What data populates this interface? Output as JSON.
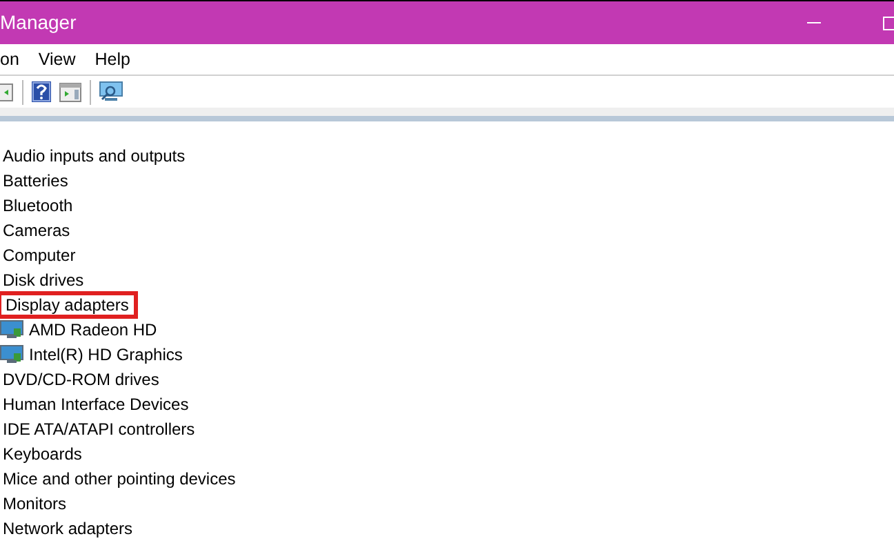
{
  "window": {
    "title": "Manager"
  },
  "menu": [
    "on",
    "View",
    "Help"
  ],
  "tree": [
    {
      "label": "Audio inputs and outputs",
      "highlighted": false
    },
    {
      "label": "Batteries",
      "highlighted": false
    },
    {
      "label": "Bluetooth",
      "highlighted": false
    },
    {
      "label": "Cameras",
      "highlighted": false
    },
    {
      "label": "Computer",
      "highlighted": false
    },
    {
      "label": "Disk drives",
      "highlighted": false
    },
    {
      "label": "Display adapters",
      "highlighted": true,
      "children": [
        {
          "label": "AMD Radeon HD"
        },
        {
          "label": "Intel(R) HD Graphics"
        }
      ]
    },
    {
      "label": "DVD/CD-ROM drives",
      "highlighted": false
    },
    {
      "label": "Human Interface Devices",
      "highlighted": false
    },
    {
      "label": "IDE ATA/ATAPI controllers",
      "highlighted": false
    },
    {
      "label": "Keyboards",
      "highlighted": false
    },
    {
      "label": "Mice and other pointing devices",
      "highlighted": false
    },
    {
      "label": "Monitors",
      "highlighted": false
    },
    {
      "label": "Network adapters",
      "highlighted": false
    }
  ]
}
